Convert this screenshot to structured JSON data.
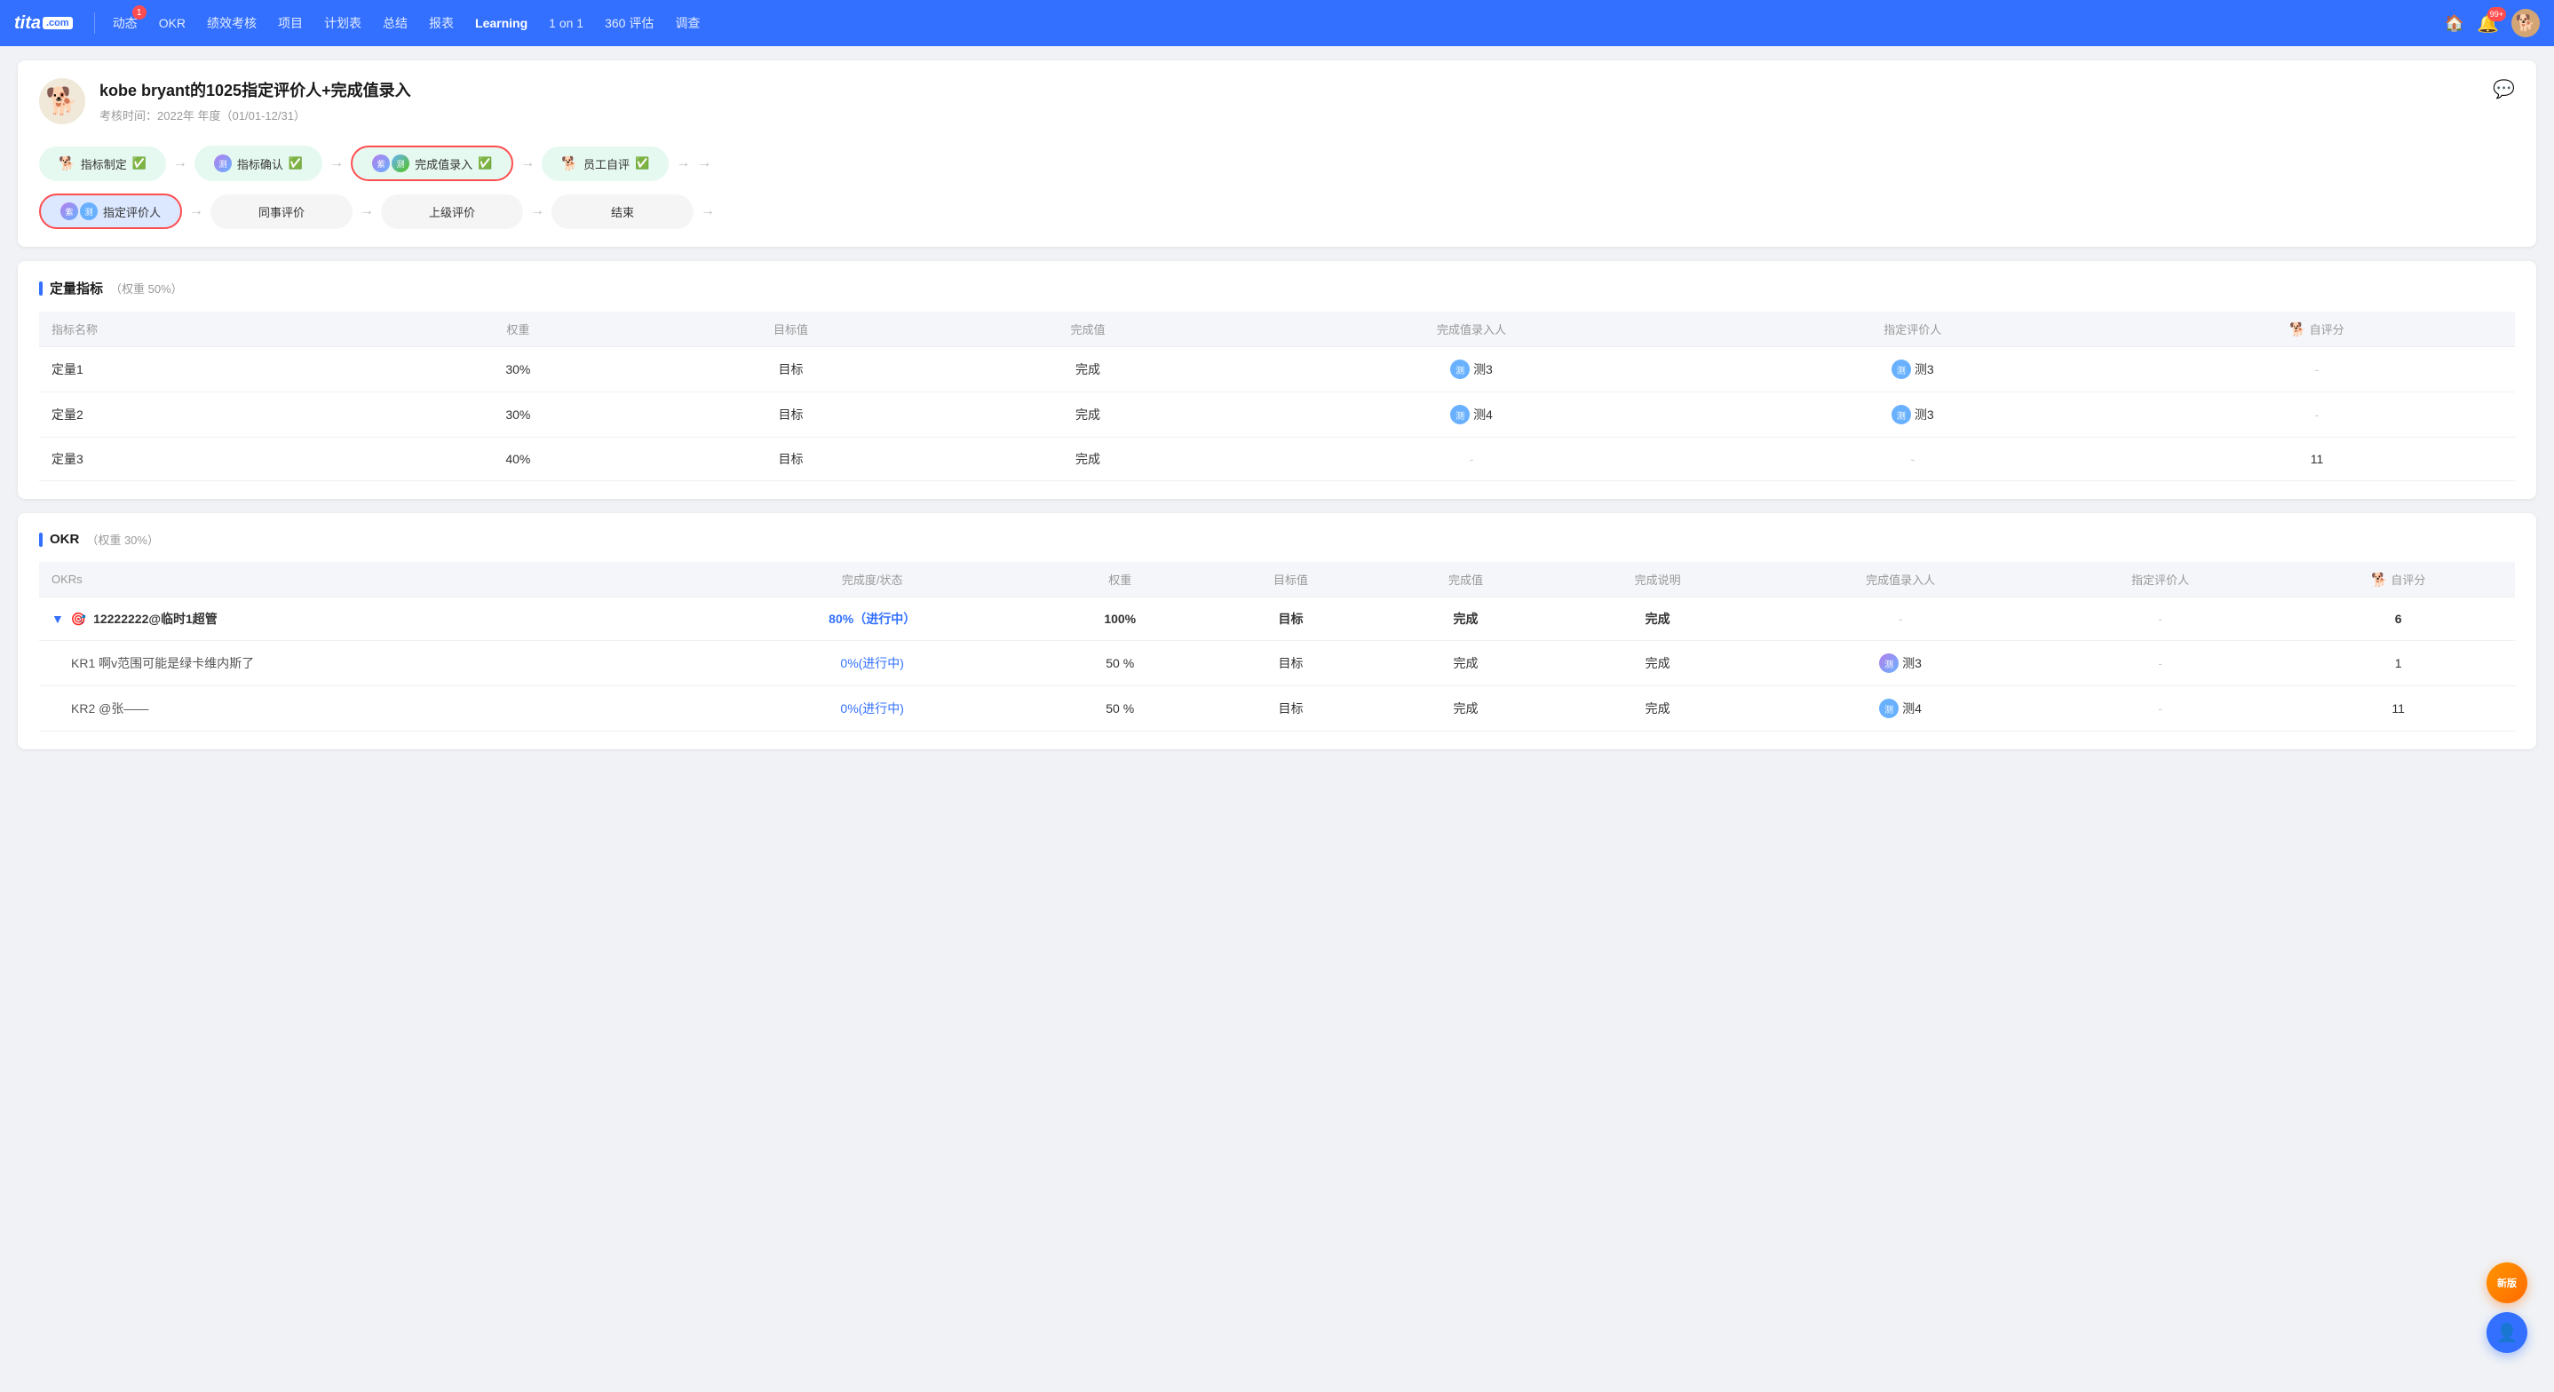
{
  "nav": {
    "logo": "tita",
    "logo_com": ".com",
    "items": [
      {
        "label": "动态",
        "badge": "1",
        "active": false
      },
      {
        "label": "OKR",
        "badge": null,
        "active": false
      },
      {
        "label": "绩效考核",
        "badge": null,
        "active": false
      },
      {
        "label": "项目",
        "badge": null,
        "active": false
      },
      {
        "label": "计划表",
        "badge": null,
        "active": false
      },
      {
        "label": "总结",
        "badge": null,
        "active": false
      },
      {
        "label": "报表",
        "badge": null,
        "active": false
      },
      {
        "label": "Learning",
        "badge": null,
        "active": true
      },
      {
        "label": "1 on 1",
        "badge": null,
        "active": false
      },
      {
        "label": "360 评估",
        "badge": null,
        "active": false
      },
      {
        "label": "调查",
        "badge": null,
        "active": false
      }
    ],
    "notif_badge": "99+",
    "home_icon": "🏠"
  },
  "page": {
    "title": "kobe bryant的1025指定评价人+完成值录入",
    "subtitle": "考核时间：2022年 年度（01/01-12/31）"
  },
  "workflow_row1": [
    {
      "label": "指标制定",
      "type": "green",
      "check": true,
      "avatar": "dog"
    },
    {
      "label": "指标确认",
      "type": "green",
      "check": true,
      "avatar": "ce"
    },
    {
      "label": "完成值录入",
      "type": "green_red",
      "check": true,
      "avatar": "ce_purple"
    },
    {
      "label": "员工自评",
      "type": "green",
      "check": true,
      "avatar": "dog"
    }
  ],
  "workflow_row2": [
    {
      "label": "指定评价人",
      "type": "blue_red",
      "avatar": "ce_purple"
    },
    {
      "label": "同事评价",
      "type": "plain"
    },
    {
      "label": "上级评价",
      "type": "plain"
    },
    {
      "label": "结束",
      "type": "plain"
    }
  ],
  "quantitative": {
    "title": "定量指标",
    "weight": "（权重 50%）",
    "headers": [
      "指标名称",
      "权重",
      "目标值",
      "完成值",
      "完成值录入人",
      "指定评价人",
      "自评分"
    ],
    "rows": [
      {
        "name": "定量1",
        "weight": "30%",
        "target": "目标",
        "completion": "完成",
        "recorder": {
          "text": "测3",
          "color": "#69b1ff"
        },
        "evaluator": {
          "text": "测3",
          "color": "#69b1ff"
        },
        "score": "-"
      },
      {
        "name": "定量2",
        "weight": "30%",
        "target": "目标",
        "completion": "完成",
        "recorder": {
          "text": "测4",
          "color": "#69b1ff"
        },
        "evaluator": {
          "text": "测3",
          "color": "#69b1ff"
        },
        "score": "-"
      },
      {
        "name": "定量3",
        "weight": "40%",
        "target": "目标",
        "completion": "完成",
        "recorder": "-",
        "evaluator": "-",
        "score": "11"
      }
    ]
  },
  "okr": {
    "title": "OKR",
    "weight": "（权重 30%）",
    "headers": [
      "OKRs",
      "完成度/状态",
      "权重",
      "目标值",
      "完成值",
      "完成说明",
      "完成值录入人",
      "指定评价人",
      "自评分"
    ],
    "rows": [
      {
        "type": "main",
        "name": "12222222@临时1超管",
        "progress": "80%（进行中）",
        "weight": "100%",
        "target": "目标",
        "completion": "完成",
        "description": "完成",
        "recorder": "-",
        "evaluator": "-",
        "score": "6"
      },
      {
        "type": "kr",
        "name": "KR1 啊v范围可能是绿卡维内斯了",
        "progress": "0%(进行中)",
        "weight": "50",
        "weight_unit": "%",
        "target": "目标",
        "completion": "完成",
        "description": "完成",
        "recorder": {
          "text": "测3",
          "color": "#b37feb"
        },
        "evaluator": "-",
        "score": "1"
      },
      {
        "type": "kr",
        "name": "KR2 @张——",
        "progress": "0%(进行中)",
        "weight": "50",
        "weight_unit": "%",
        "target": "目标",
        "completion": "完成",
        "description": "完成",
        "recorder": {
          "text": "测4",
          "color": "#69b1ff"
        },
        "evaluator": "-",
        "score": "11"
      }
    ]
  },
  "float_buttons": {
    "new_version": "新版",
    "support_icon": "👤"
  }
}
